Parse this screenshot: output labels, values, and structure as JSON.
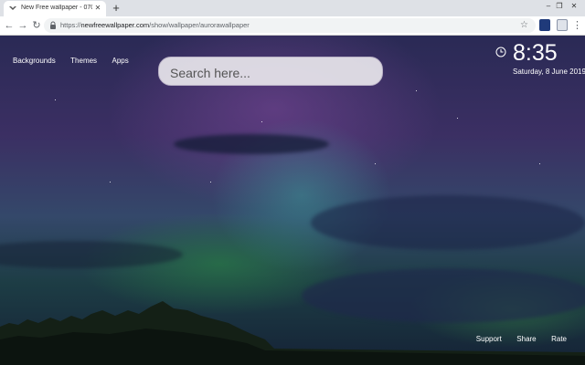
{
  "browser": {
    "tab": {
      "title": "New Free wallpaper - 07062019...",
      "close": "✕",
      "favicon": "wallpaper-favicon-icon"
    },
    "new_tab": "+",
    "window_controls": {
      "minimize": "–",
      "restore": "❐",
      "close": "✕"
    },
    "nav": {
      "back": "←",
      "forward": "→",
      "reload": "↻"
    },
    "url": {
      "scheme": "https://",
      "host": "newfreewallpaper.com",
      "path": "/show/wallpaper/aurorawallpaper"
    },
    "bookmark_star": "☆",
    "menu": "⋮"
  },
  "page": {
    "nav_links": [
      "Backgrounds",
      "Themes",
      "Apps"
    ],
    "search": {
      "placeholder": "Search here..."
    },
    "clock": {
      "time": "8:35",
      "date": "Saturday, 8 June 2019"
    },
    "footer_links": [
      "Support",
      "Share",
      "Rate"
    ],
    "colors": {
      "sky_top": "#2a2a55",
      "aurora_green": "#3c8a4a",
      "aurora_purple": "#7a4696"
    }
  }
}
